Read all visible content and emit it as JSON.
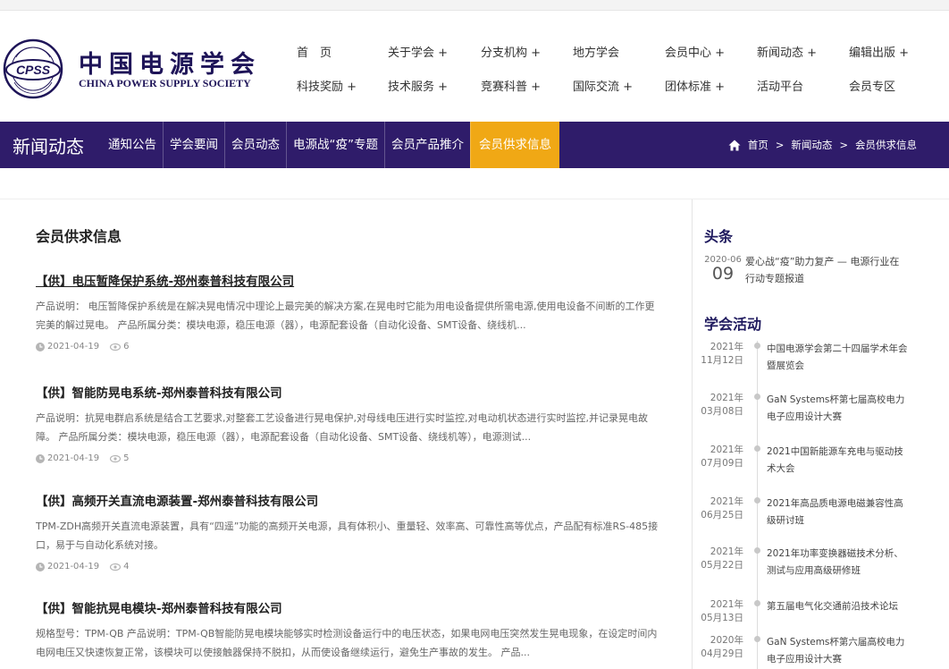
{
  "brand": {
    "name_cn": "中国电源学会",
    "name_en": "CHINA POWER SUPPLY SOCIETY",
    "emblem_text": "CPSS"
  },
  "main_nav": {
    "row1": [
      "首　页",
      "关于学会 +",
      "分支机构 +",
      "地方学会",
      "会员中心 +",
      "新闻动态 +",
      "编辑出版 +"
    ],
    "row2": [
      "科技奖励 +",
      "技术服务 +",
      "竞赛科普 +",
      "国际交流 +",
      "团体标准 +",
      "活动平台",
      "会员专区"
    ]
  },
  "subbar": {
    "title": "新闻动态",
    "tabs": [
      "通知公告",
      "学会要闻",
      "会员动态",
      "电源战“疫”专题",
      "会员产品推介",
      "会员供求信息"
    ],
    "active_tab": "会员供求信息",
    "breadcrumb": [
      "首页",
      ">",
      "新闻动态",
      ">",
      "会员供求信息"
    ]
  },
  "main": {
    "section_title": "会员供求信息",
    "articles": [
      {
        "title": "【供】电压暂降保护系统-郑州泰普科技有限公司",
        "desc": "产品说明：  电压暂降保护系统是在解决晃电情况中理论上最完美的解决方案,在晃电时它能为用电设备提供所需电源,使用电设备不间断的工作更完美的解过晃电。 产品所属分类：模块电源，稳压电源（器），电源配套设备（自动化设备、SMT设备、绕线机...",
        "date": "2021-04-19",
        "views": "6"
      },
      {
        "title": "【供】智能防晃电系统-郑州泰普科技有限公司",
        "desc": "产品说明：抗晃电群启系统是结合工艺要求,对整套工艺设备进行晃电保护,对母线电压进行实时监控,对电动机状态进行实时监控,并记录晃电故障。 产品所属分类：模块电源，稳压电源（器），电源配套设备（自动化设备、SMT设备、绕线机等），电源测试...",
        "date": "2021-04-19",
        "views": "5"
      },
      {
        "title": "【供】高频开关直流电源装置-郑州泰普科技有限公司",
        "desc": "TPM-ZDH高频开关直流电源装置，具有“四遥”功能的高频开关电源，具有体积小、重量轻、效率高、可靠性高等优点，产品配有标准RS-485接口，易于与自动化系统对接。",
        "date": "2021-04-19",
        "views": "4"
      },
      {
        "title": "【供】智能抗晃电模块-郑州泰普科技有限公司",
        "desc": "规格型号：TPM-QB 产品说明：TPM-QB智能防晃电模块能够实时检测设备运行中的电压状态，如果电网电压突然发生晃电现象，在设定时间内电网电压又快速恢复正常，该模块可以使接触器保持不脱扣，从而使设备继续运行，避免生产事故的发生。 产品...",
        "date": "",
        "views": ""
      }
    ]
  },
  "sidebar": {
    "headline_title": "头条",
    "headline": {
      "year_month": "2020-06",
      "day": "09",
      "text": "爱心战“疫”助力复产 — 电源行业在行动专题报道"
    },
    "activities_title": "学会活动",
    "activities": [
      {
        "year": "2021年",
        "md": "11月12日",
        "text": "中国电源学会第二十四届学术年会暨展览会"
      },
      {
        "year": "2021年",
        "md": "03月08日",
        "text": "GaN Systems杯第七届高校电力电子应用设计大赛"
      },
      {
        "year": "2021年",
        "md": "07月09日",
        "text": "2021中国新能源车充电与驱动技术大会"
      },
      {
        "year": "2021年",
        "md": "06月25日",
        "text": "2021年高品质电源电磁兼容性高级研讨班"
      },
      {
        "year": "2021年",
        "md": "05月22日",
        "text": "2021年功率变换器磁技术分析、测试与应用高级研修班"
      },
      {
        "year": "2021年",
        "md": "05月13日",
        "text": "第五届电气化交通前沿技术论坛"
      },
      {
        "year": "2020年",
        "md": "04月29日",
        "text": "GaN Systems杯第六届高校电力电子应用设计大赛"
      }
    ]
  },
  "colors": {
    "brand_navy": "#1e1458",
    "subbar_purple": "#2f1c6a",
    "active_orange": "#f0a815"
  },
  "icons": [
    "cpss-emblem",
    "home-icon",
    "clock-icon",
    "eye-icon"
  ]
}
